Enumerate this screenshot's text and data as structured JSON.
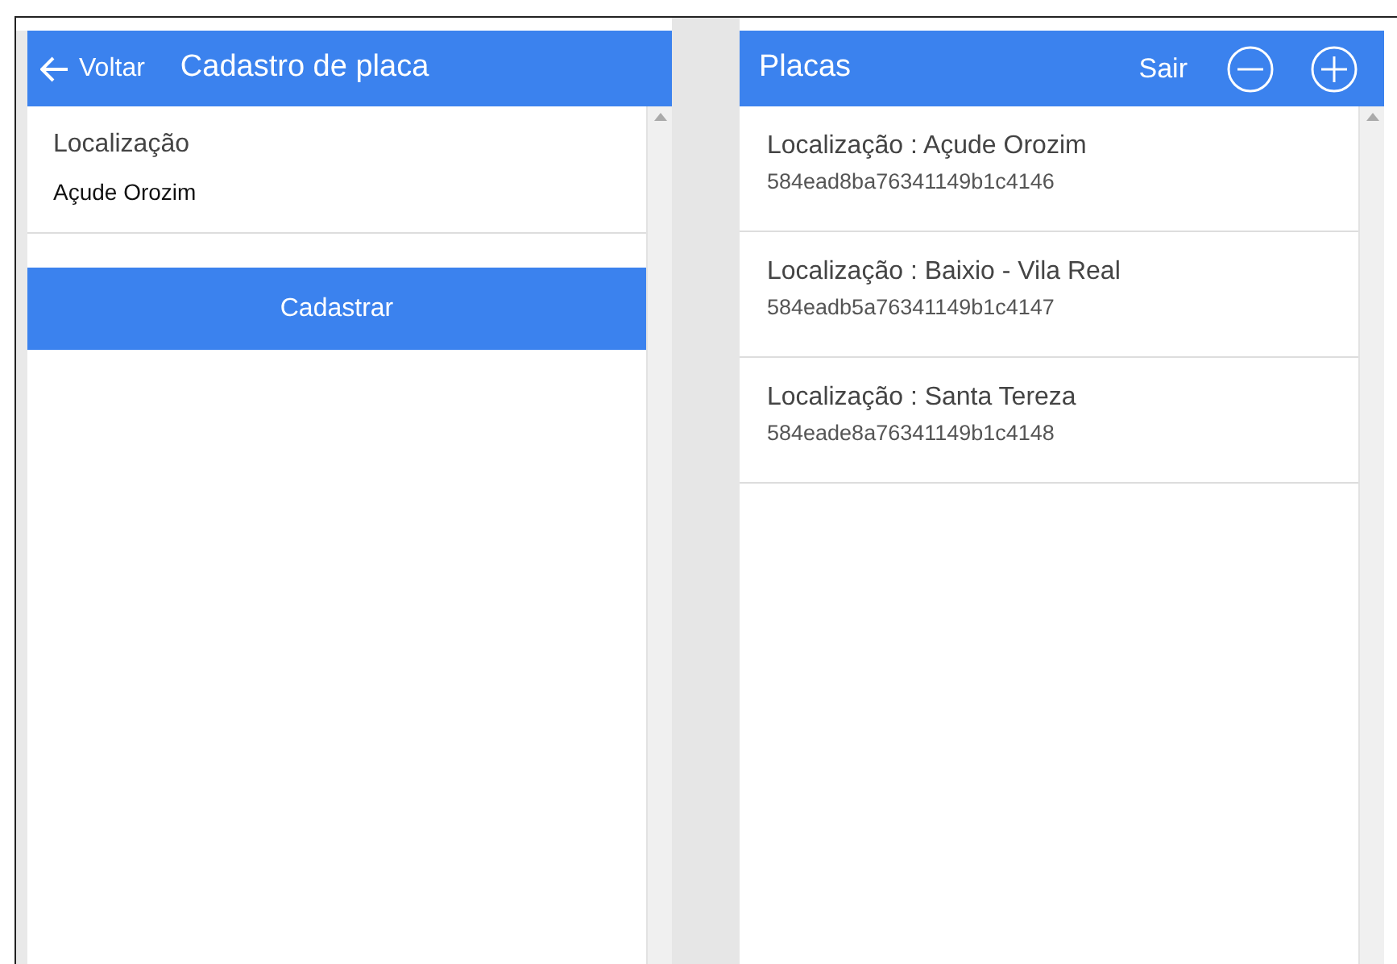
{
  "left_panel": {
    "back_label": "Voltar",
    "title": "Cadastro de placa",
    "field": {
      "label": "Localização",
      "value": "Açude Orozim"
    },
    "submit_button": "Cadastrar"
  },
  "right_panel": {
    "title": "Placas",
    "logout_label": "Sair",
    "items": [
      {
        "title": "Localização : Açude Orozim",
        "id": "584ead8ba76341149b1c4146"
      },
      {
        "title": "Localização : Baixio - Vila Real",
        "id": "584eadb5a76341149b1c4147"
      },
      {
        "title": "Localização : Santa Tereza",
        "id": "584eade8a76341149b1c4148"
      }
    ]
  }
}
